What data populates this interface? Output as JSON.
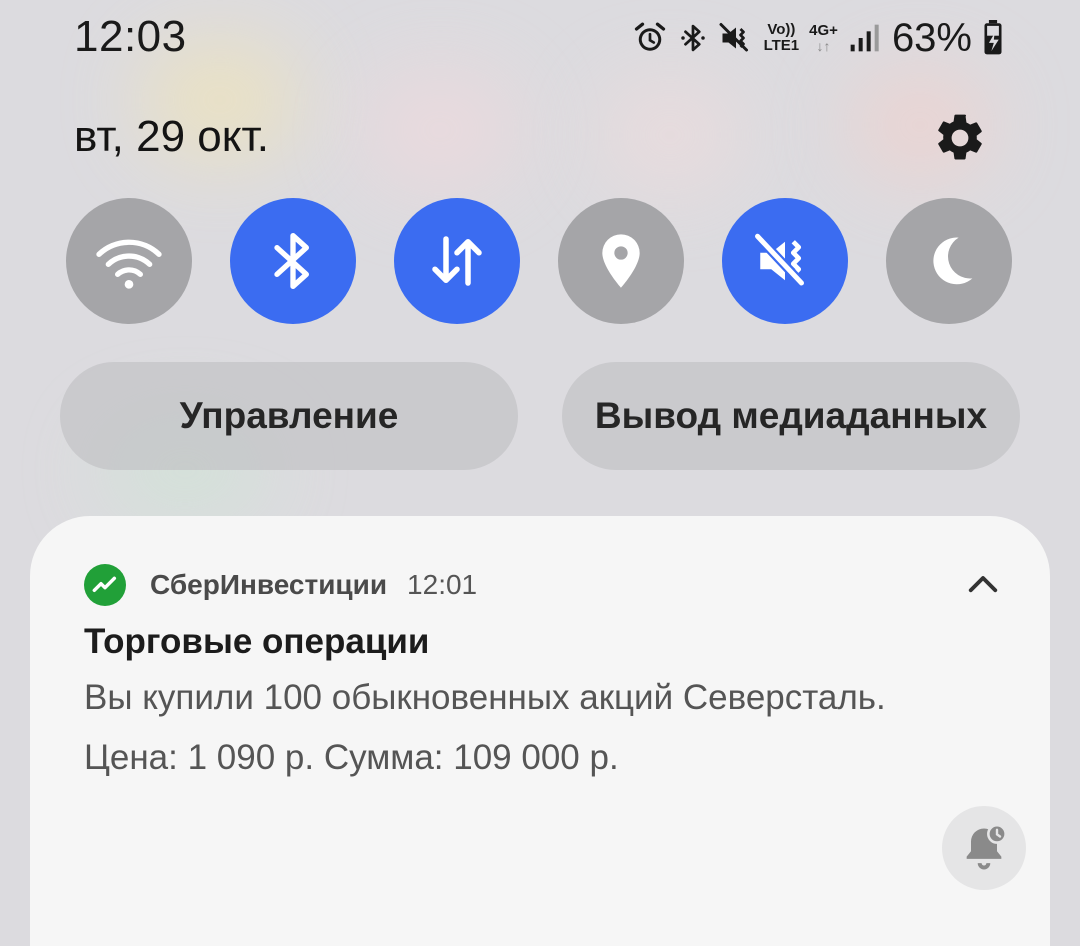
{
  "status_bar": {
    "time": "12:03",
    "volte_label": "Vo))",
    "lte_label": "LTE1",
    "network_label": "4G+",
    "battery_percent": "63%",
    "icons": [
      "alarm-icon",
      "bluetooth-icon",
      "vibrate-icon",
      "volte-icon",
      "data-arrows-icon",
      "signal-icon",
      "battery-charging-icon"
    ]
  },
  "header": {
    "date": "вт, 29 окт.",
    "settings_icon": "gear-icon"
  },
  "quick_tiles": [
    {
      "name": "wifi",
      "icon": "wifi-icon",
      "state": "off"
    },
    {
      "name": "bluetooth",
      "icon": "bluetooth-icon",
      "state": "on"
    },
    {
      "name": "mobile-data",
      "icon": "data-arrows-icon",
      "state": "on"
    },
    {
      "name": "location",
      "icon": "location-pin-icon",
      "state": "off"
    },
    {
      "name": "vibrate",
      "icon": "vibrate-icon",
      "state": "on"
    },
    {
      "name": "night-mode",
      "icon": "moon-icon",
      "state": "off"
    }
  ],
  "buttons": {
    "control": "Управление",
    "media_output": "Вывод медиаданных"
  },
  "notification": {
    "app_name": "СберИнвестиции",
    "time": "12:01",
    "title": "Торговые операции",
    "line1": "Вы купили 100 обыкновенных акций Северсталь.",
    "line2": "Цена: 1 090 р. Сумма: 109 000 р.",
    "app_icon": "sber-icon",
    "collapse_icon": "chevron-up-icon",
    "snooze_icon": "bell-snooze-icon"
  },
  "colors": {
    "tile_on": "#3b6cf1",
    "tile_off": "#a5a5a8",
    "sber_green": "#21a038"
  }
}
